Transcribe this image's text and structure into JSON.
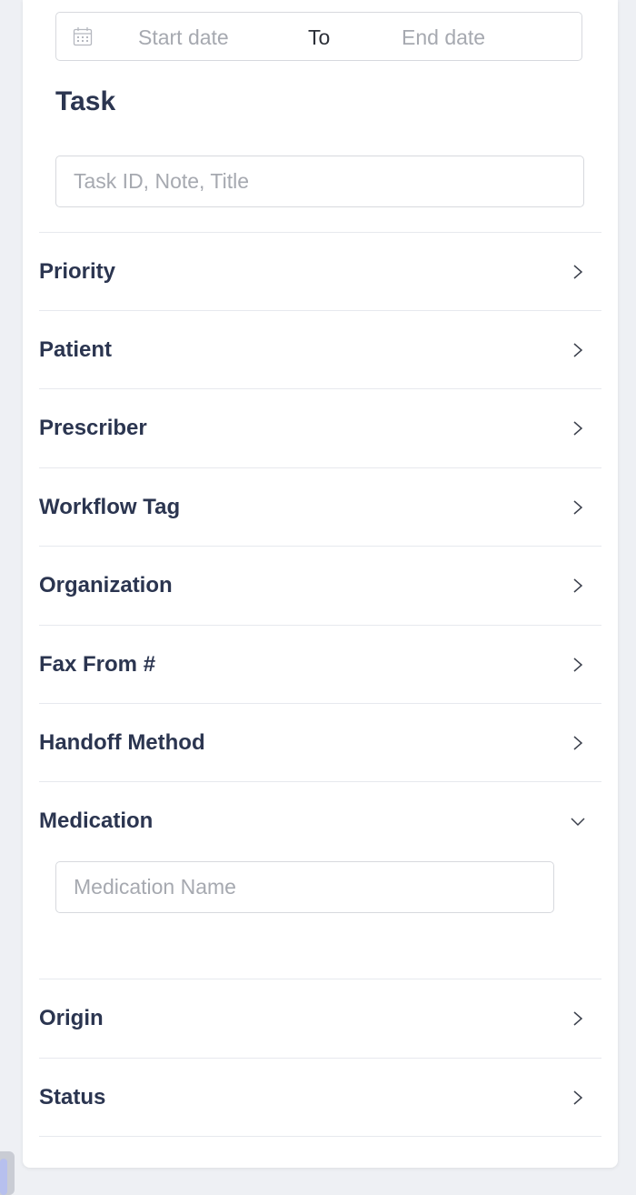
{
  "date_range": {
    "icon": "calendar-icon",
    "start_placeholder": "Start date",
    "separator": "To",
    "end_placeholder": "End date"
  },
  "task": {
    "heading": "Task",
    "placeholder": "Task ID, Note, Title"
  },
  "filters": [
    {
      "label": "Priority",
      "state": "collapsed"
    },
    {
      "label": "Patient",
      "state": "collapsed"
    },
    {
      "label": "Prescriber",
      "state": "collapsed"
    },
    {
      "label": "Workflow Tag",
      "state": "collapsed"
    },
    {
      "label": "Organization",
      "state": "collapsed"
    },
    {
      "label": "Fax From #",
      "state": "collapsed"
    },
    {
      "label": "Handoff Method",
      "state": "collapsed"
    },
    {
      "label": "Medication",
      "state": "expanded",
      "input_placeholder": "Medication Name"
    },
    {
      "label": "Origin",
      "state": "collapsed"
    },
    {
      "label": "Status",
      "state": "collapsed"
    }
  ],
  "icons": {
    "collapsed": "chevron-right-icon",
    "expanded": "chevron-down-icon"
  },
  "colors": {
    "label": "#2b3550",
    "placeholder": "#a6a9b0",
    "border": "#d7d9de",
    "divider": "#e7e9ee"
  }
}
